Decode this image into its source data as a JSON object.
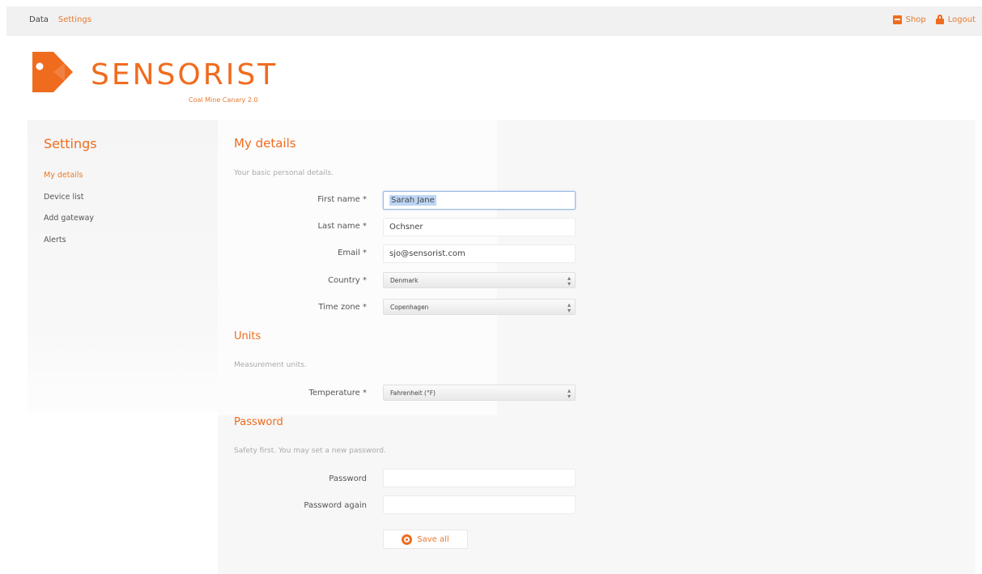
{
  "nav": {
    "data_label": "Data",
    "settings_label": "Settings",
    "shop_label": "Shop",
    "logout_label": "Logout"
  },
  "brand": {
    "name": "SENSORIST",
    "tagline": "Coal Mine Canary 2.0"
  },
  "sidebar": {
    "title": "Settings",
    "items": [
      {
        "label": "My details",
        "active": true
      },
      {
        "label": "Device list",
        "active": false
      },
      {
        "label": "Add gateway",
        "active": false
      },
      {
        "label": "Alerts",
        "active": false
      }
    ]
  },
  "my_details": {
    "title": "My details",
    "description": "Your basic personal details.",
    "first_name_label": "First name *",
    "first_name_value": "Sarah Jane",
    "last_name_label": "Last name *",
    "last_name_value": "Ochsner",
    "email_label": "Email *",
    "email_value": "sjo@sensorist.com",
    "country_label": "Country *",
    "country_value": "Denmark",
    "timezone_label": "Time zone *",
    "timezone_value": "Copenhagen"
  },
  "units": {
    "title": "Units",
    "description": "Measurement units.",
    "temperature_label": "Temperature *",
    "temperature_value": "Fahrenheit (°F)"
  },
  "password": {
    "title": "Password",
    "description": "Safety first. You may set a new password.",
    "password_label": "Password",
    "password_again_label": "Password again"
  },
  "actions": {
    "save_label": "Save all"
  },
  "colors": {
    "accent": "#ef6c1f"
  },
  "icons": {
    "shop": "shop-icon",
    "logout": "lock-icon",
    "save": "save-icon",
    "select_arrow": "select-arrows-icon"
  }
}
